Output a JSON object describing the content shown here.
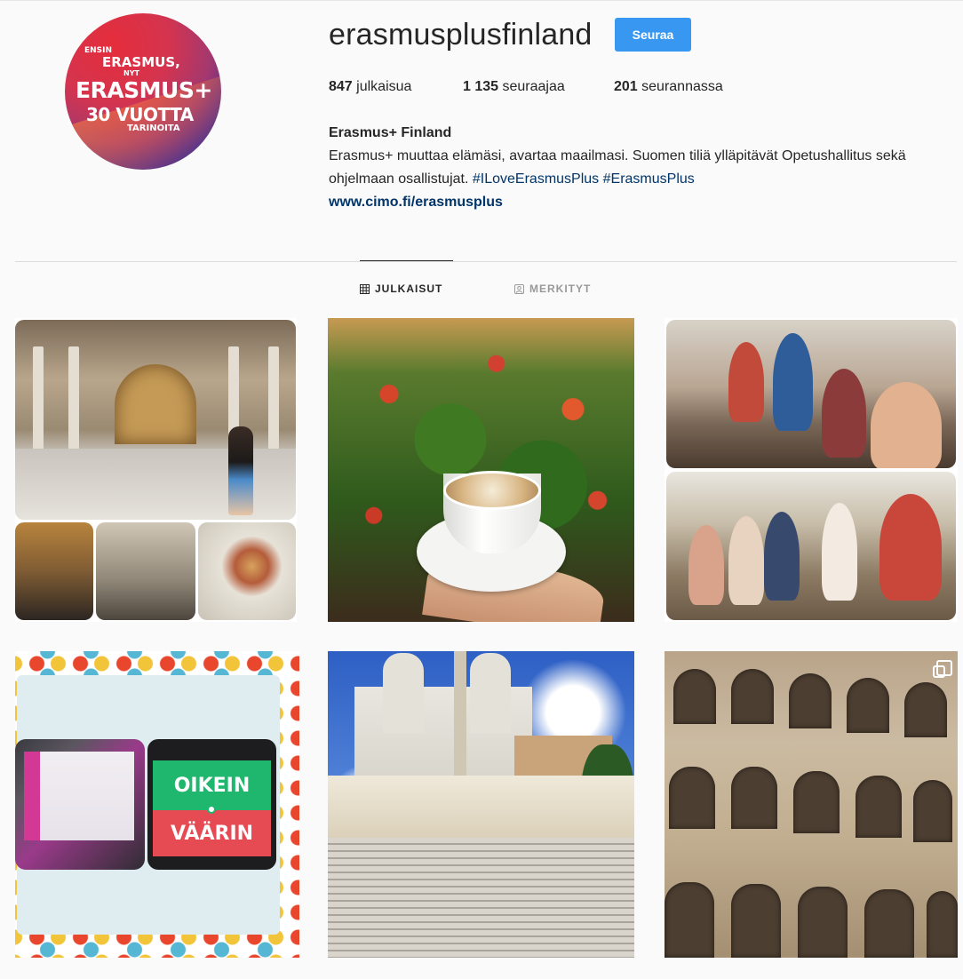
{
  "profile": {
    "username": "erasmusplusfinland",
    "follow_label": "Seuraa",
    "avatar_text": [
      "ENSIN",
      "ERASMUS,",
      "NYT",
      "ERASMUS+",
      "30 VUOTTA",
      "TARINOITA"
    ],
    "stats": [
      {
        "count": "847",
        "label": "julkaisua"
      },
      {
        "count": "1 135",
        "label": "seuraajaa"
      },
      {
        "count": "201",
        "label": "seurannassa"
      }
    ],
    "bio": {
      "name": "Erasmus+ Finland",
      "text": "Erasmus+ muuttaa elämäsi, avartaa maailmasi. Suomen tiliä ylläpitävät Opetushallitus sekä ohjelmaan osallistujat.",
      "hashtags": [
        "#ILoveErasmusPlus",
        "#ErasmusPlus"
      ],
      "link": "www.cimo.fi/erasmusplus"
    }
  },
  "tabs": [
    {
      "label": "JULKAISUT",
      "icon": "grid-icon",
      "active": true
    },
    {
      "label": "MERKITYT",
      "icon": "tagged-icon",
      "active": false
    }
  ],
  "posts": [
    {
      "subject": "church-interior-collage"
    },
    {
      "subject": "cappuccino-flowers"
    },
    {
      "subject": "friends-collage"
    },
    {
      "subject": "quiz-oikein-vaarin",
      "overlay_text": [
        "OIKEIN",
        "VÄÄRIN"
      ]
    },
    {
      "subject": "spanish-steps"
    },
    {
      "subject": "colosseum",
      "badge": "multi-photo-icon"
    }
  ],
  "colors": {
    "follow_button": "#3897f0",
    "link": "#003569",
    "text": "#262626",
    "muted": "#999999",
    "background": "#fafafa"
  }
}
